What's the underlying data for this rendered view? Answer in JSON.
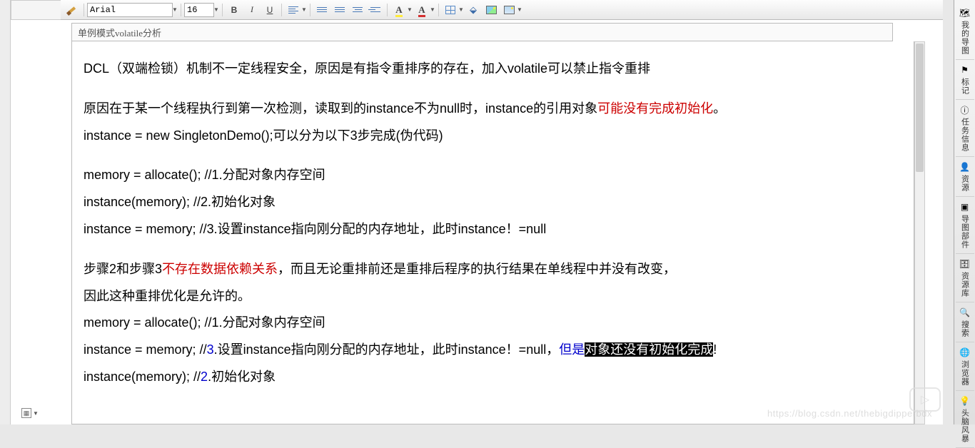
{
  "toolbar": {
    "font_family": "Arial",
    "font_size": "16",
    "bold": "B",
    "italic": "I",
    "underline": "U"
  },
  "title": "单例模式volatile分析",
  "doc": {
    "p1_a": "DCL（双端检锁）机制不一定线程安全，原因是有指令重排序的存在，加入volatile可以禁止指令重排",
    "p2_a": "原因在于某一个线程执行到第一次检测，读取到的instance不为null时，instance的引用对象",
    "p2_b": "可能没有完成初始化",
    "p2_c": "。",
    "p3": "instance = new SingletonDemo();可以分为以下3步完成(伪代码)",
    "p4": "memory = allocate(); //1.分配对象内存空间",
    "p5": "instance(memory);    //2.初始化对象",
    "p6": "instance = memory;   //3.设置instance指向刚分配的内存地址，此时instance！=null",
    "p7_a": "步骤2和步骤3",
    "p7_b": "不存在数据依赖关系",
    "p7_c": "，而且无论重排前还是重排后程序的执行结果在单线程中并没有改变，",
    "p8": "因此这种重排优化是允许的。",
    "p9": "memory = allocate(); //1.分配对象内存空间",
    "p10_a": "instance = memory;   //",
    "p10_b": "3",
    "p10_c": ".设置instance指向刚分配的内存地址，此时instance！=null，",
    "p10_d": "但是",
    "p10_e": "对象还没有初始化完成",
    "p10_f": "!",
    "p11_a": "instance(memory);    //",
    "p11_b": "2",
    "p11_c": ".初始化对象"
  },
  "rail": {
    "i1": "我的导图",
    "i2": "标记",
    "i3": "任务信息",
    "i4": "资源",
    "i5": "导图部件",
    "i6": "资源库",
    "i7": "搜索",
    "i8": "浏览器",
    "i9": "头脑风暴"
  },
  "watermark": "https://blog.csdn.net/thebigdipperbdx"
}
